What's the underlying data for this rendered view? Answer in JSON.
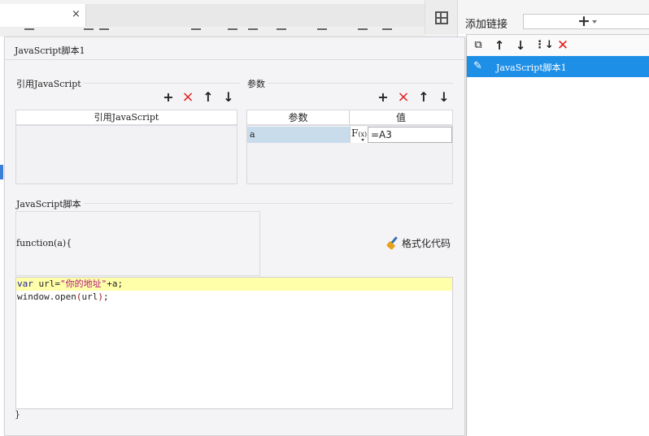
{
  "editor": {
    "tab_close": "×"
  },
  "right_panel": {
    "title": "添加链接",
    "add_plus": "+",
    "tools": [
      "copy-icon",
      "arrow-up-icon",
      "arrow-down-icon",
      "move-bottom-icon",
      "delete-icon"
    ],
    "items": [
      {
        "label": "JavaScript脚本1",
        "selected": true
      }
    ]
  },
  "dialog": {
    "title": "JavaScript脚本1",
    "ref_section": {
      "label": "引用JavaScript",
      "column_header": "引用JavaScript"
    },
    "param_section": {
      "label": "参数",
      "headers": [
        "参数",
        "值"
      ],
      "rows": [
        {
          "name": "a",
          "fx": "F(x)",
          "value": "=A3"
        }
      ]
    },
    "script_section": {
      "label": "JavaScript脚本",
      "func_open": "function(a){",
      "func_close": "}",
      "format_button": "格式化代码",
      "code_line1": {
        "kw": "var",
        "rest": " url=",
        "str": "\"你的地址\"",
        "tail": "+a;"
      },
      "code_line2": {
        "obj": "window.open",
        "lp": "(",
        "arg": "url",
        "rp": ")",
        "semi": ";"
      }
    },
    "buttons": {
      "add": "+",
      "delete": "×",
      "up": "↑",
      "down": "↓"
    }
  },
  "colors": {
    "accent_selected": "#1e8fe6",
    "delete_red": "#e02020",
    "active_line": "#ffffaa",
    "selected_cell": "#c9dceb"
  }
}
